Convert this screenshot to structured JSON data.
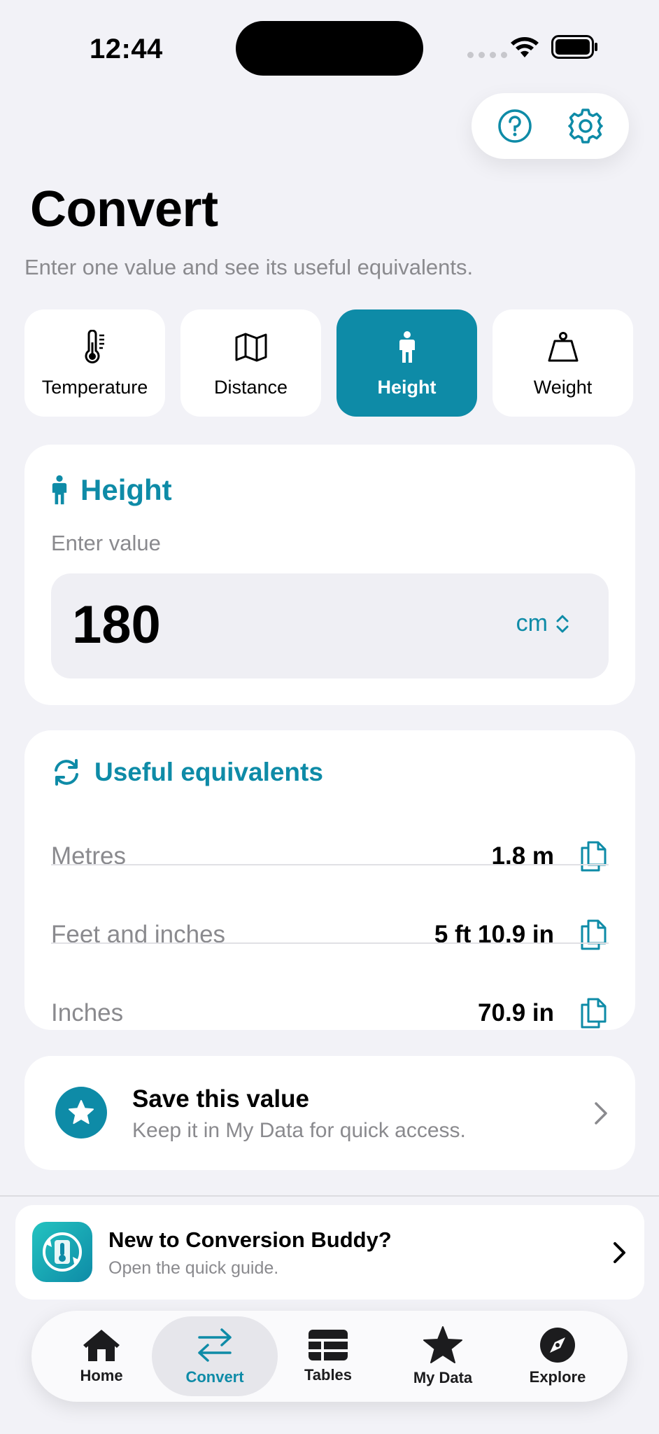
{
  "status_bar": {
    "time": "12:44"
  },
  "page": {
    "title": "Convert",
    "subtitle": "Enter one value and see its useful equivalents."
  },
  "categories": [
    {
      "label": "Temperature",
      "icon": "thermometer-icon",
      "active": false
    },
    {
      "label": "Distance",
      "icon": "map-icon",
      "active": false
    },
    {
      "label": "Height",
      "icon": "person-icon",
      "active": true
    },
    {
      "label": "Weight",
      "icon": "weight-icon",
      "active": false
    }
  ],
  "input_card": {
    "title": "Height",
    "enter_label": "Enter value",
    "value": "180",
    "unit": "cm"
  },
  "equivalents": {
    "title": "Useful equivalents",
    "rows": [
      {
        "name": "Metres",
        "value": "1.8 m"
      },
      {
        "name": "Feet and inches",
        "value": "5 ft 10.9 in"
      },
      {
        "name": "Inches",
        "value": "70.9 in"
      }
    ]
  },
  "save": {
    "title": "Save this value",
    "subtitle": "Keep it in My Data for quick access."
  },
  "guide": {
    "title": "New to Conversion Buddy?",
    "subtitle": "Open the quick guide."
  },
  "tabbar": {
    "items": [
      {
        "label": "Home",
        "icon": "home-icon",
        "active": false
      },
      {
        "label": "Convert",
        "icon": "convert-arrows-icon",
        "active": true
      },
      {
        "label": "Tables",
        "icon": "table-icon",
        "active": false
      },
      {
        "label": "My Data",
        "icon": "star-icon",
        "active": false
      },
      {
        "label": "Explore",
        "icon": "compass-icon",
        "active": false
      }
    ]
  },
  "colors": {
    "accent": "#0E8BA7",
    "background": "#F2F2F7",
    "secondary_text": "#8A8A8E"
  }
}
